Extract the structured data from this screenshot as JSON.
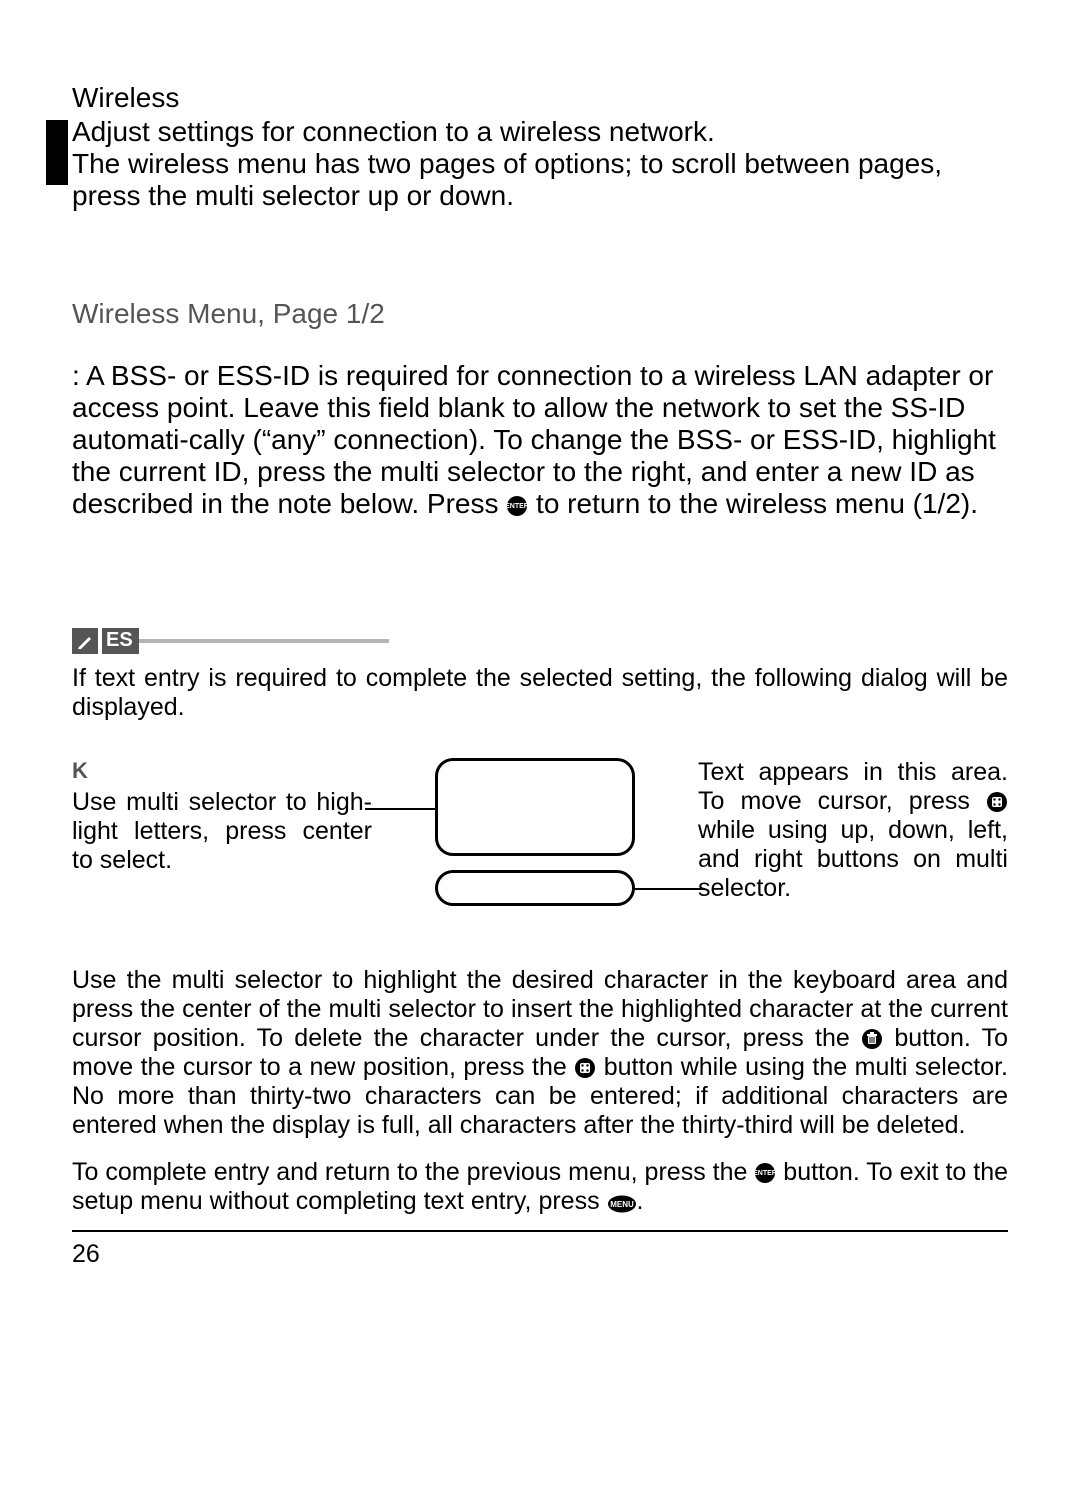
{
  "section": {
    "title": "Wireless",
    "intro1": "Adjust settings for connection to a wireless network.",
    "intro2": "The wireless menu has two pages of options; to scroll between pages, press the multi selector up or down."
  },
  "subheading": "Wireless Menu, Page 1/2",
  "ssid": {
    "para_before": ": A BSS- or ESS-ID is required for connection to a wireless LAN adapter or access point.  Leave this ﬁeld blank to allow the network to set the SS-ID automati-cally (“any” connection).  To change the BSS- or ESS-ID, highlight the current ID, press the multi selector to the right, and enter a new ID as described in the note below.  Press ",
    "para_after": " to return to the wireless menu (1/2)."
  },
  "note": {
    "header_label": "ES",
    "intro": "If text entry is required to complete the selected setting, the following dialog will be displayed.",
    "kb_left_title": "K",
    "kb_left_text": "Use multi selector to high-light letters, press center to select.",
    "kb_right_a": "Text appears in this area. To move cursor, press ",
    "kb_right_b": " while using up, down, left, and right buttons on multi selector.",
    "para2_a": "Use the multi selector to highlight the desired character in the keyboard area and press the center of the multi selector to insert the highlighted character at the current cursor position.  To delete the character under the cursor, press the ",
    "para2_b": " button.  To move the cursor to a new position, press the ",
    "para2_c": " button while using the multi selector.  No more than thirty-two characters can be entered; if additional characters are entered when the display is full, all characters after the thirty-third will be deleted.",
    "para3_a": "To complete entry and return to the previous menu, press the ",
    "para3_b": " button.  To exit to the setup menu without completing text entry, press ",
    "para3_c": "."
  },
  "icons": {
    "enter": "enter-icon",
    "trash": "trash-icon",
    "zoom": "zoom-icon",
    "menu": "menu-icon",
    "pencil": "pencil-icon"
  },
  "page_number": "26"
}
